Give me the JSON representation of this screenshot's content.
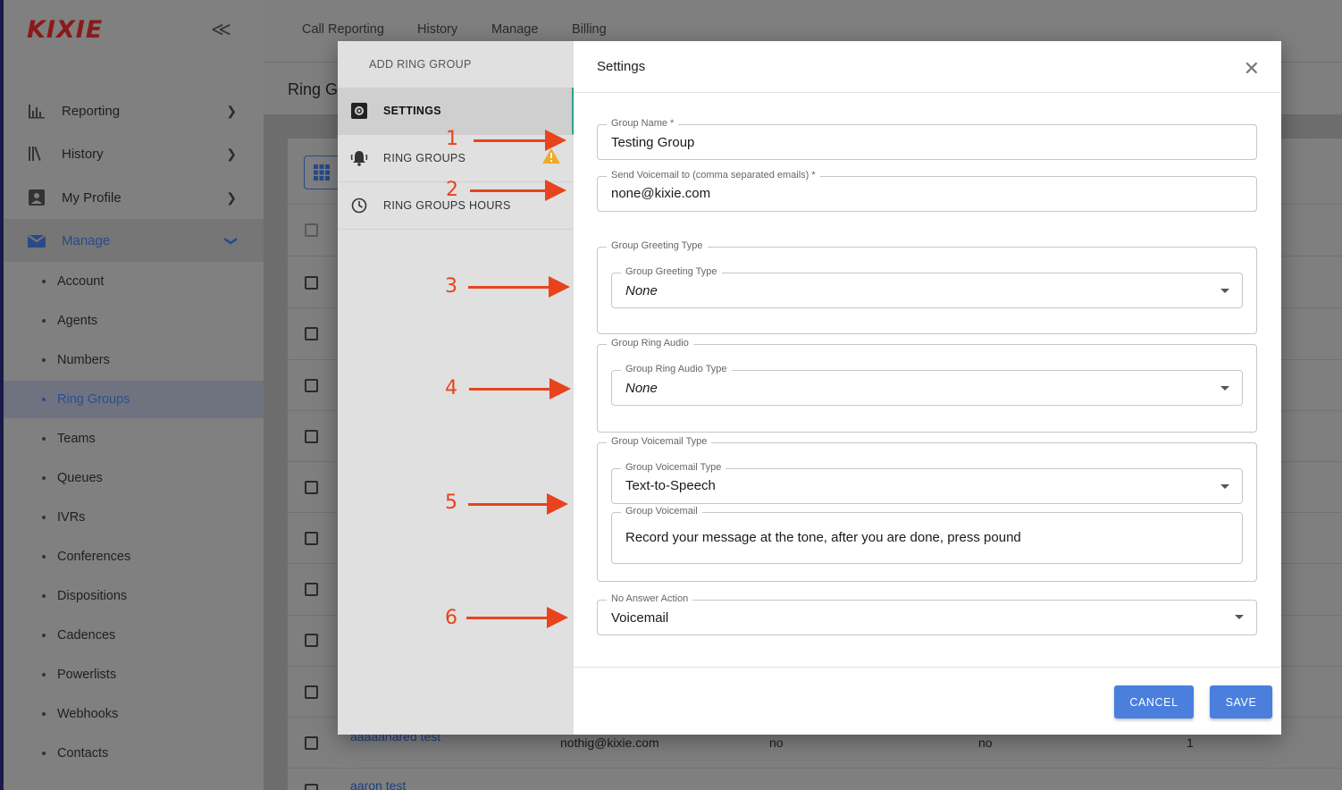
{
  "brand": {
    "logo": "KIXIE",
    "collapse_icon": "double-chevron-left-icon"
  },
  "sidebar": {
    "items": [
      {
        "label": "Reporting",
        "icon": "bar-chart-icon"
      },
      {
        "label": "History",
        "icon": "history-icon"
      },
      {
        "label": "My Profile",
        "icon": "profile-icon"
      },
      {
        "label": "Manage",
        "icon": "manage-icon",
        "expanded": true
      }
    ],
    "subitems": [
      "Account",
      "Agents",
      "Numbers",
      "Ring Groups",
      "Teams",
      "Queues",
      "IVRs",
      "Conferences",
      "Dispositions",
      "Cadences",
      "Powerlists",
      "Webhooks",
      "Contacts"
    ],
    "active_subitem": "Ring Groups"
  },
  "topnav": {
    "tabs": [
      "Call Reporting",
      "History",
      "Manage",
      "Billing"
    ]
  },
  "page": {
    "title": "Ring G"
  },
  "table": {
    "rows": [
      {
        "name": "aaaaanared test",
        "email": "nothig@kixie.com",
        "col3": "no",
        "col4": "no",
        "col5": "1"
      },
      {
        "name": "aaron test",
        "email": "",
        "col3": "",
        "col4": "",
        "col5": ""
      }
    ]
  },
  "modal": {
    "left_title": "ADD RING GROUP",
    "nav": [
      {
        "label": "SETTINGS",
        "icon": "settings-icon"
      },
      {
        "label": "RING GROUPS",
        "icon": "bell-icon",
        "warning": true
      },
      {
        "label": "RING GROUPS HOURS",
        "icon": "clock-icon"
      }
    ],
    "title": "Settings",
    "fields": {
      "group_name": {
        "label": "Group Name *",
        "value": "Testing Group"
      },
      "voicemail_to": {
        "label": "Send Voicemail to (comma separated emails) *",
        "value": "none@kixie.com"
      },
      "greeting_group": {
        "label": "Group Greeting Type"
      },
      "greeting_type": {
        "label": "Group Greeting Type",
        "value": "None"
      },
      "ring_audio_group": {
        "label": "Group Ring Audio"
      },
      "ring_audio_type": {
        "label": "Group Ring Audio Type",
        "value": "None"
      },
      "voicemail_group": {
        "label": "Group Voicemail Type"
      },
      "voicemail_type": {
        "label": "Group Voicemail Type",
        "value": "Text-to-Speech"
      },
      "group_voicemail": {
        "label": "Group Voicemail",
        "value": "Record your message at the tone, after you are done, press pound"
      },
      "no_answer_action": {
        "label": "No Answer Action",
        "value": "Voicemail"
      }
    },
    "buttons": {
      "cancel": "CANCEL",
      "save": "SAVE"
    }
  },
  "annotations": [
    "1",
    "2",
    "3",
    "4",
    "5",
    "6"
  ],
  "colors": {
    "accent": "#4a7fde",
    "annotation": "#e8431c",
    "logo": "#8a1a1a",
    "active_tab_border": "#2aa38a",
    "warning": "#f0a92a"
  }
}
